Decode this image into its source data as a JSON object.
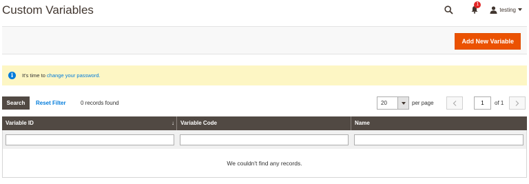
{
  "header": {
    "title": "Custom Variables",
    "notification_count": "1",
    "user_name": "testing"
  },
  "actions": {
    "add_button_label": "Add New Variable"
  },
  "message": {
    "text": "It's time to",
    "link_text": "change your password."
  },
  "grid_controls": {
    "search_label": "Search",
    "reset_filter_label": "Reset Filter",
    "records_found": "0 records found",
    "per_page_value": "20",
    "per_page_label": "per page",
    "current_page": "1",
    "total_pages_label": "of 1"
  },
  "grid": {
    "columns": [
      {
        "label": "Variable ID",
        "sort": "↓"
      },
      {
        "label": "Variable Code"
      },
      {
        "label": "Name"
      }
    ],
    "empty_text": "We couldn't find any records."
  },
  "colors": {
    "accent": "#eb5202",
    "header_dark": "#514943",
    "link": "#007bdb",
    "notice_bg": "#fdf6c4"
  },
  "icons": [
    "search-icon",
    "bell-icon",
    "user-icon",
    "info-icon",
    "chevron-left-icon",
    "chevron-right-icon"
  ]
}
